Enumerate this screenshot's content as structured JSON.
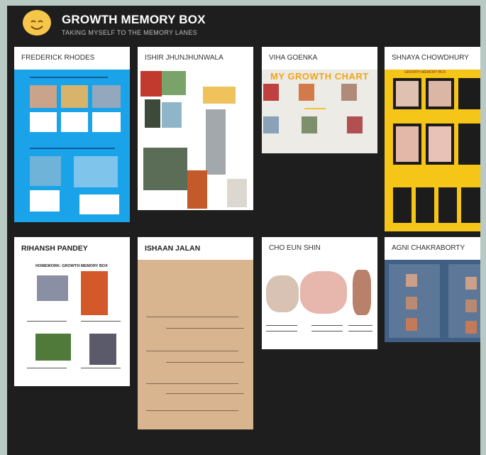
{
  "board": {
    "title": "GROWTH MEMORY BOX",
    "subtitle": "TAKING MYSELF TO THE MEMORY LANES"
  },
  "cards": [
    {
      "name": "FREDERICK RHODES"
    },
    {
      "name": "ISHIR JHUNJHUNWALA"
    },
    {
      "name": "VIHA GOENKA",
      "thumb_text": "MY GROWTH CHART"
    },
    {
      "name": "SHNAYA CHOWDHURY",
      "thumb_text": "GROWTH MEMORY BOX"
    },
    {
      "name": "RIHANSH PANDEY",
      "thumb_text": "HOMEWORK: GROWTH MEMORY BOX"
    },
    {
      "name": "ISHAAN JALAN"
    },
    {
      "name": "CHO EUN SHIN"
    },
    {
      "name": "AGNI CHAKRABORTY"
    }
  ],
  "colors": {
    "frame": "#b9c9c4",
    "board_bg": "#1e1e1e",
    "card_bg": "#ffffff",
    "accent_blue": "#1aa3e8",
    "accent_yellow": "#f5c518"
  }
}
